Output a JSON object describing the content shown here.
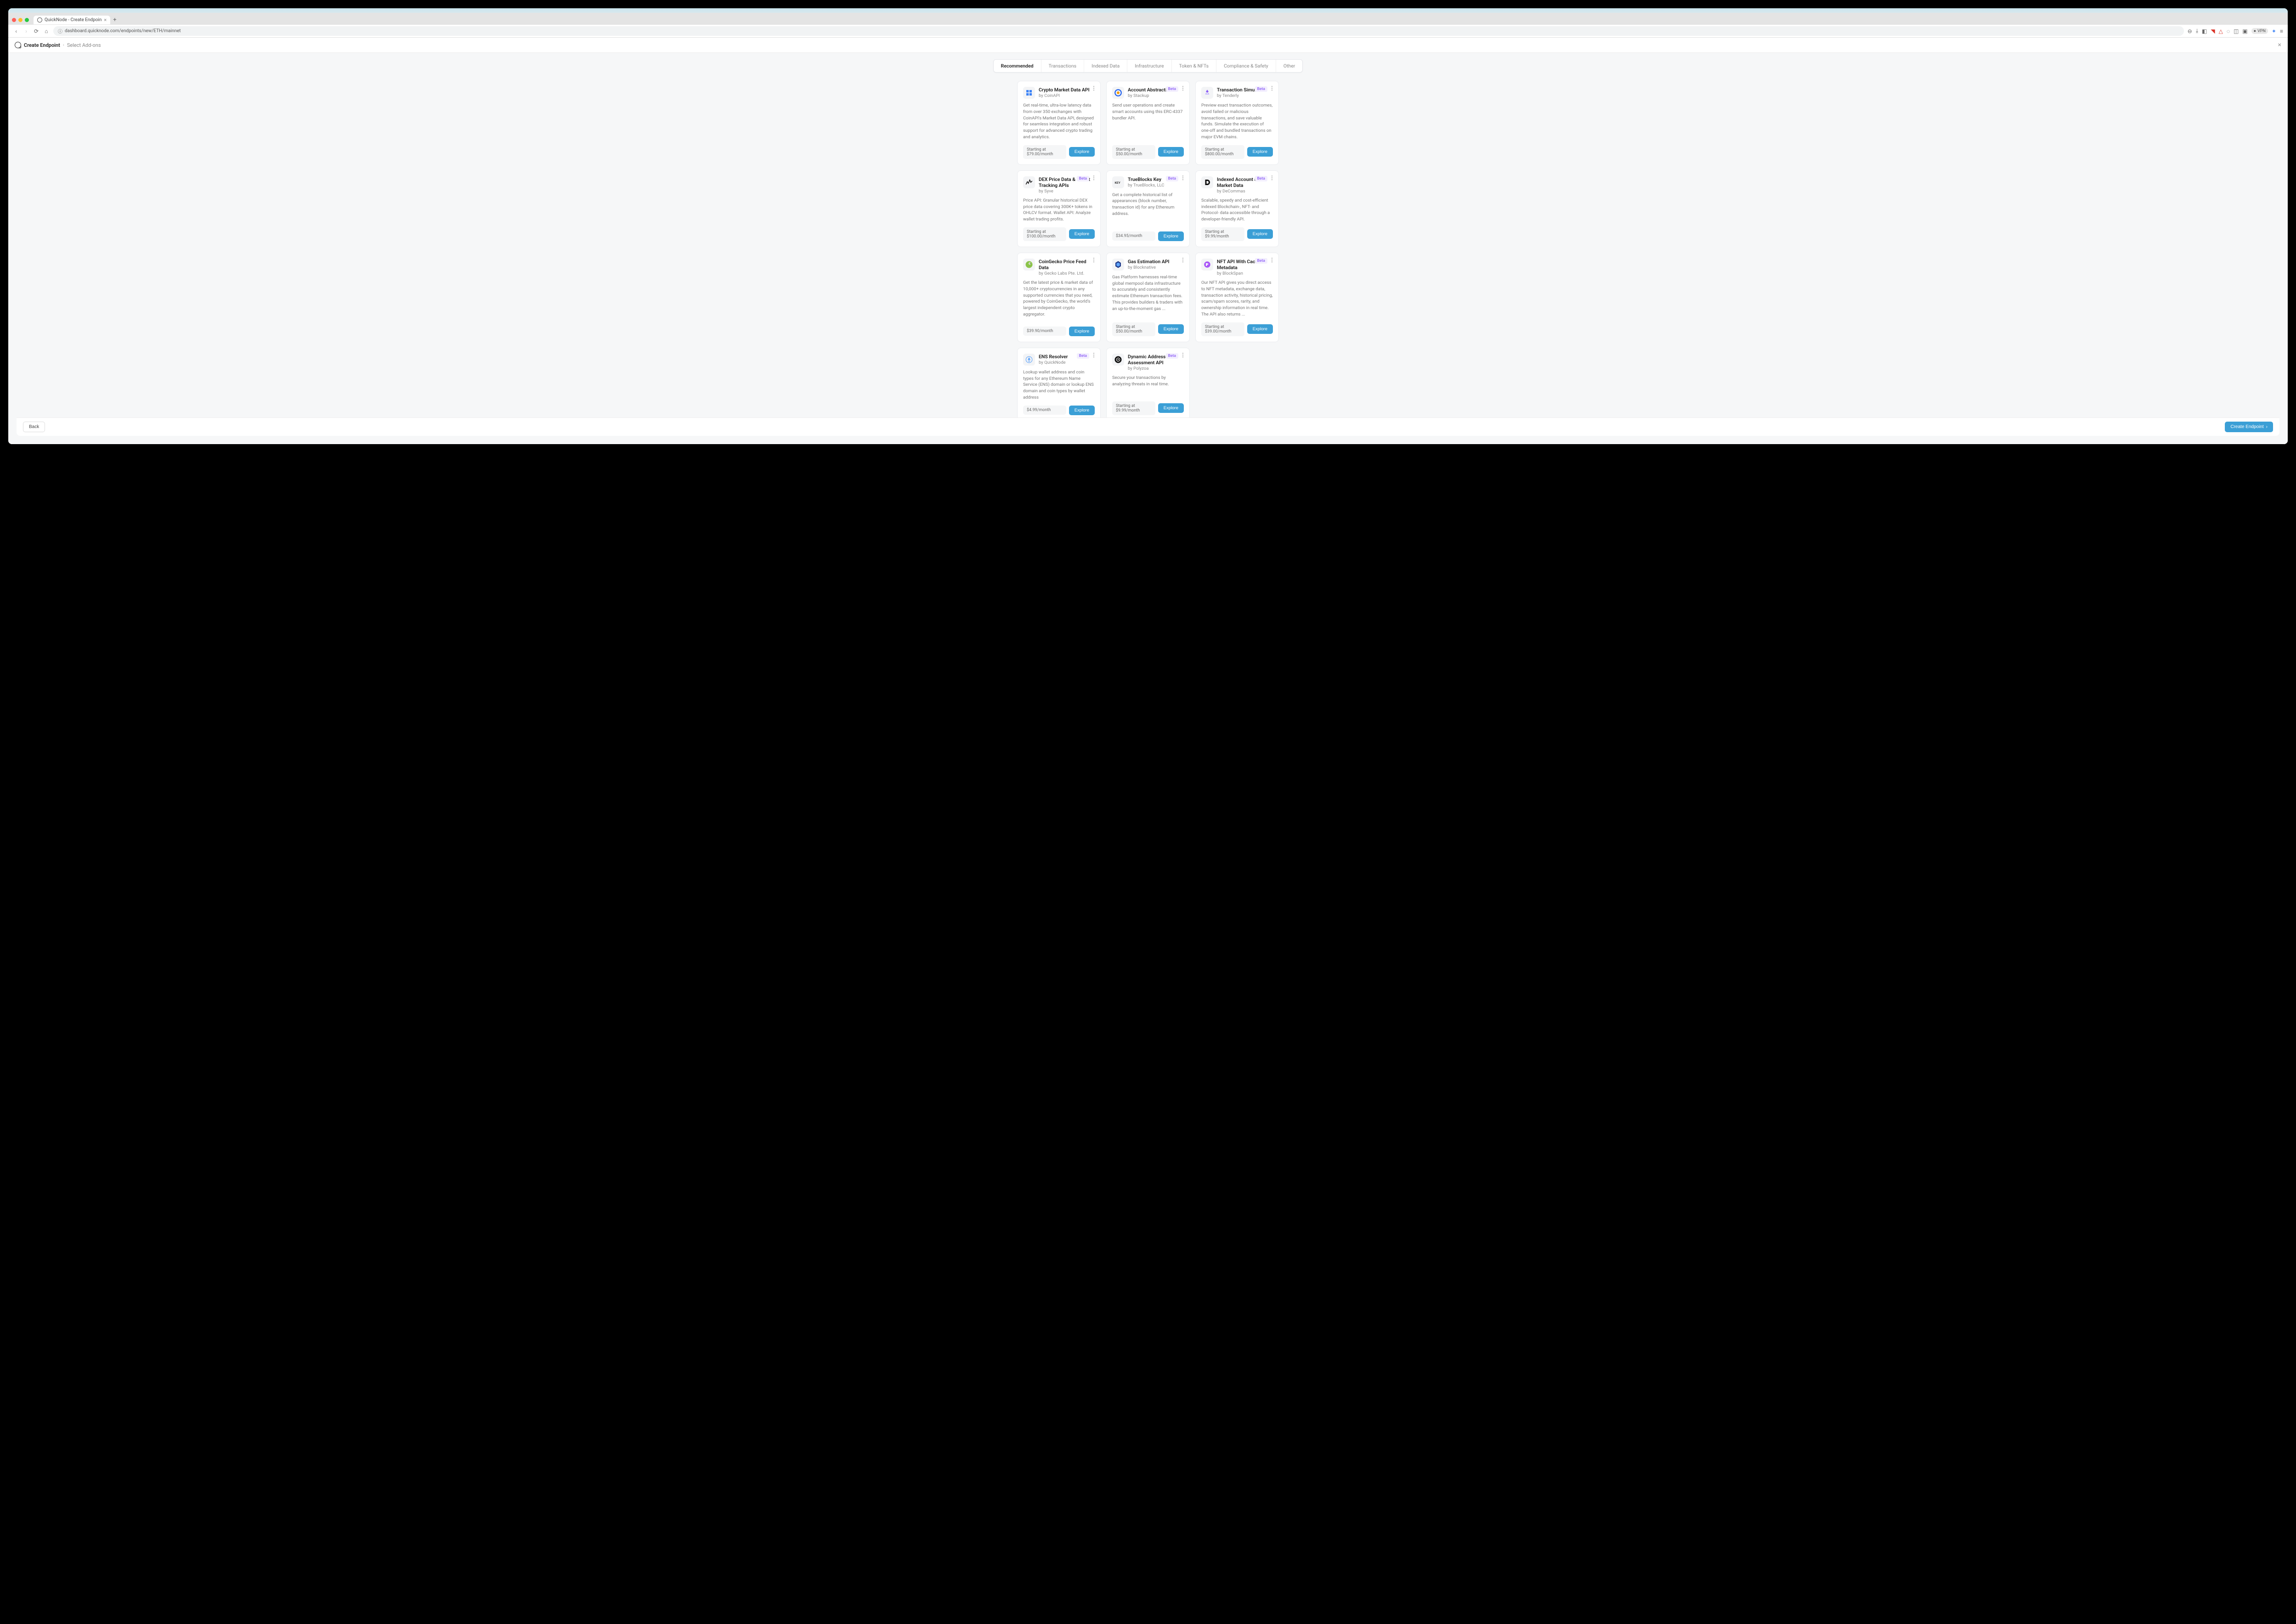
{
  "browser": {
    "tab_title": "QuickNode - Create Endpoin",
    "url": "dashboard.quicknode.com/endpoints/new/ETH/mainnet",
    "vpn_label": "VPN"
  },
  "breadcrumb": {
    "title": "Create Endpoint",
    "step": "Select Add-ons"
  },
  "tabs": [
    "Recommended",
    "Transactions",
    "Indexed Data",
    "Infrastructure",
    "Token & NFTs",
    "Compliance & Safety",
    "Other"
  ],
  "active_tab": "Recommended",
  "cards": [
    {
      "title": "Crypto Market Data API",
      "vendor": "by CoinAPI",
      "beta": false,
      "desc": "Get real-time, ultra-low latency data from over 350 exchanges with CoinAPI's Market Data API, designed for seamless integration and robust support for advanced crypto trading and analytics.",
      "price": "Starting at $79.00/month",
      "icon": "coinapi"
    },
    {
      "title": "Account Abstraction",
      "vendor": "by Stackup",
      "beta": true,
      "desc": "Send user operations and create smart accounts using this ERC-4337 bundler API.",
      "price": "Starting at $50.00/month",
      "icon": "stackup"
    },
    {
      "title": "Transaction Simulator",
      "vendor": "by Tenderly",
      "beta": true,
      "desc": "Preview exact transaction outcomes, avoid failed or malicious transactions, and save valuable funds. Simulate the execution of one-off and bundled transactions on major EVM chains.",
      "price": "Starting at $800.00/month",
      "icon": "tenderly"
    },
    {
      "title": "DEX Price Data & Wallet Tracking APIs",
      "vendor": "by Syve",
      "beta": true,
      "desc": "Price API: Granular historical DEX price data covering 300K+ tokens in OHLCV format. Wallet API: Analyze wallet trading profits.",
      "price": "Starting at $100.00/month",
      "icon": "syve"
    },
    {
      "title": "TrueBlocks Key",
      "vendor": "by TrueBlocks, LLC",
      "beta": true,
      "desc": "Get a complete historical list of appearances (block number, transaction id) for any Ethereum address.",
      "price": "$34.95/month",
      "icon": "key"
    },
    {
      "title": "Indexed Account & Market Data",
      "vendor": "by DeCommas",
      "beta": true,
      "desc": "Scalable, speedy and cost-efficient indexed Blockchain-, NFT- and Protocol- data accessible through a developer-friendly API.",
      "price": "Starting at $9.99/month",
      "icon": "decommas"
    },
    {
      "title": "CoinGecko Price Feed Data",
      "vendor": "by Gecko Labs Pte. Ltd.",
      "beta": false,
      "desc": "Get the latest price & market data of 10,000+ cryptocurrencies in any supported currencies that you need, powered by CoinGecko, the world's largest independent crypto aggregator.",
      "price": "$39.90/month",
      "icon": "gecko"
    },
    {
      "title": "Gas Estimation API",
      "vendor": "by Blocknative",
      "beta": false,
      "desc": "Gas Platform harnesses real-time global mempool data infrastructure to accurately and consistently estimate Ethereum transaction fees. This provides builders & traders with an up-to-the-moment gas ...",
      "price": "Starting at $50.00/month",
      "icon": "blocknative"
    },
    {
      "title": "NFT API With Cached Metadata",
      "vendor": "by BlockSpan",
      "beta": true,
      "desc": "Our NFT API gives you direct access to NFT metadata, exchange data, transaction activity, historical pricing, scam/spam scores, rarity, and ownership information in real time. The API also returns ...",
      "price": "Starting at $39.00/month",
      "icon": "blockspan"
    },
    {
      "title": "ENS Resolver",
      "vendor": "by QuickNode",
      "beta": true,
      "desc": "Lookup wallet address and coin types for any Ethereum Name Service (ENS) domain or lookup ENS domain and coin types by wallet address",
      "price": "$4.99/month",
      "icon": "ens"
    },
    {
      "title": "Dynamic Address Risk Assessment API",
      "vendor": "by Polyzoa",
      "beta": true,
      "desc": "Secure your transactions by analyzing threats in real time.",
      "price": "Starting at $9.99/month",
      "icon": "polyzoa"
    }
  ],
  "labels": {
    "explore": "Explore",
    "back": "Back",
    "create": "Create Endpoint",
    "beta": "Beta"
  }
}
